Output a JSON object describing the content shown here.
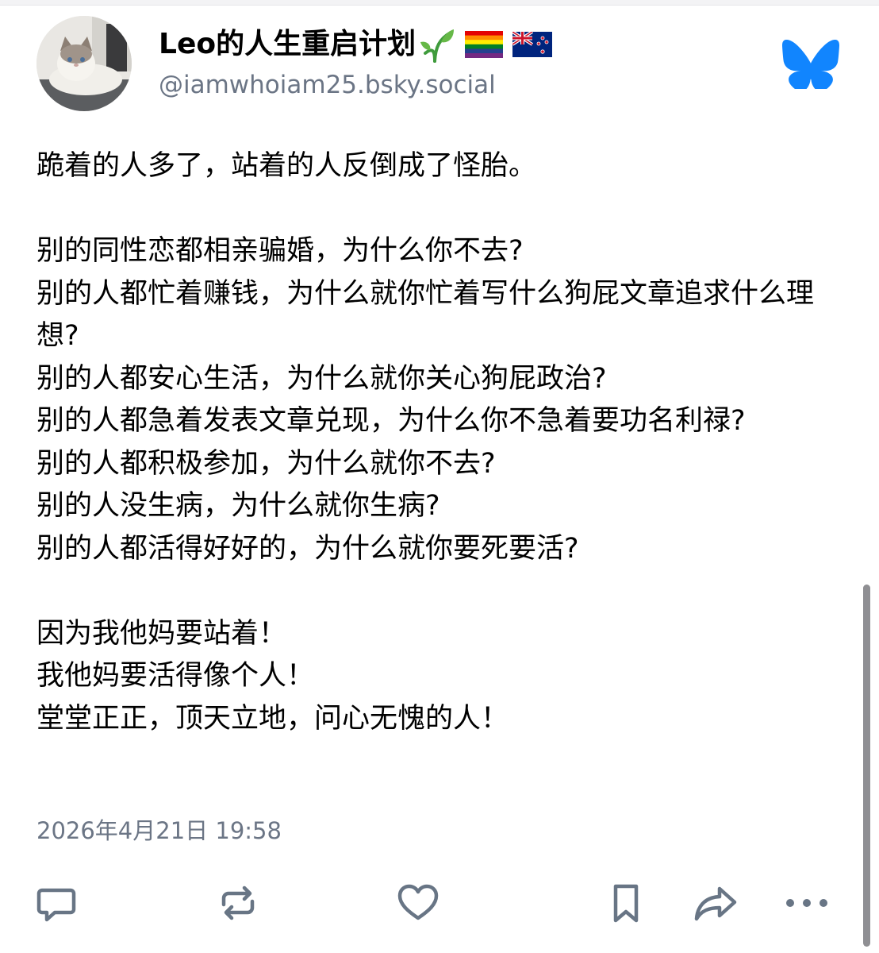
{
  "post": {
    "author": {
      "display_name": "Leo的人生重启计划",
      "handle": "@iamwhoiam25.bsky.social"
    },
    "text": "跪着的人多了，站着的人反倒成了怪胎。\n\n别的同性恋都相亲骗婚，为什么你不去?\n别的人都忙着赚钱，为什么就你忙着写什么狗屁文章追求什么理想?\n别的人都安心生活，为什么就你关心狗屁政治?\n别的人都急着发表文章兑现，为什么你不急着要功名利禄?\n别的人都积极参加，为什么就你不去?\n别的人没生病，为什么就你生病?\n别的人都活得好好的，为什么就你要死要活?\n\n因为我他妈要站着！\n我他妈要活得像个人！\n堂堂正正，顶天立地，问心无愧的人！",
    "timestamp": "2026年4月21日 19:58"
  },
  "icons": {
    "name_emojis": [
      "seedling-icon",
      "rainbow-flag-icon",
      "new-zealand-flag-icon"
    ],
    "brand": "bluesky-butterfly-icon",
    "actions": [
      "reply-icon",
      "repost-icon",
      "like-icon",
      "bookmark-icon",
      "share-icon",
      "more-icon"
    ]
  },
  "colors": {
    "brand_blue": "#1185fe",
    "icon_gray": "#687585",
    "secondary_text": "#6b7585"
  }
}
